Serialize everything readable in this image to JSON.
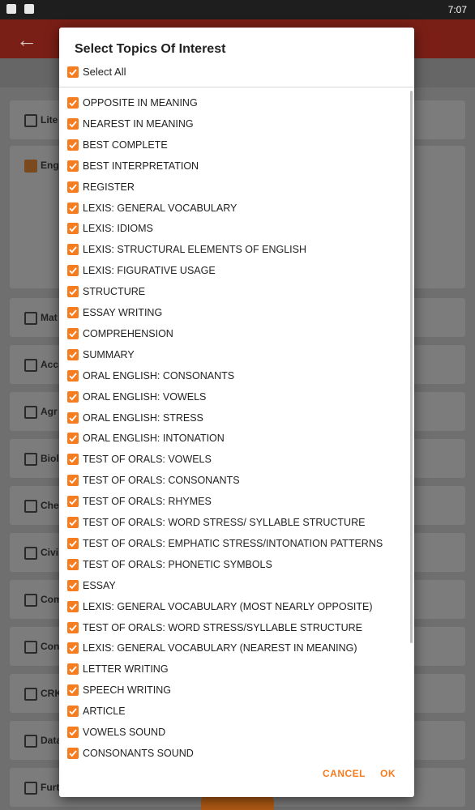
{
  "status_bar": {
    "time": "7:07"
  },
  "background": {
    "cards": [
      {
        "label": "Lite",
        "checked": false
      },
      {
        "label": "Eng",
        "checked": true
      },
      {
        "label": "Mat",
        "checked": false
      },
      {
        "label": "Acc",
        "checked": false
      },
      {
        "label": "Agr",
        "checked": false
      },
      {
        "label": "Biol",
        "checked": false
      },
      {
        "label": "Che",
        "checked": false
      },
      {
        "label": "Civi",
        "checked": false
      },
      {
        "label": "Com",
        "checked": false
      },
      {
        "label": "Con",
        "checked": false
      },
      {
        "label": "CRK",
        "checked": false
      },
      {
        "label": "Data",
        "checked": false
      },
      {
        "label": "Furt",
        "checked": false
      }
    ]
  },
  "dialog": {
    "title": "Select Topics Of Interest",
    "select_all_label": "Select All",
    "select_all_checked": true,
    "topics": [
      "OPPOSITE IN MEANING",
      "NEAREST IN MEANING",
      "BEST COMPLETE",
      "BEST INTERPRETATION",
      "REGISTER",
      "LEXIS: GENERAL VOCABULARY",
      "LEXIS: IDIOMS",
      "LEXIS: STRUCTURAL ELEMENTS OF ENGLISH",
      "LEXIS: FIGURATIVE USAGE",
      "STRUCTURE",
      "ESSAY WRITING",
      "COMPREHENSION",
      "SUMMARY",
      "ORAL ENGLISH: CONSONANTS",
      "ORAL ENGLISH: VOWELS",
      "ORAL ENGLISH: STRESS",
      "ORAL ENGLISH: INTONATION",
      "TEST OF ORALS: VOWELS",
      "TEST OF ORALS: CONSONANTS",
      "TEST OF ORALS: RHYMES",
      "TEST OF ORALS: WORD STRESS/ SYLLABLE STRUCTURE",
      "TEST OF ORALS: EMPHATIC STRESS/INTONATION PATTERNS",
      "TEST OF ORALS: PHONETIC SYMBOLS",
      "ESSAY",
      "LEXIS: GENERAL VOCABULARY (MOST NEARLY OPPOSITE)",
      "TEST OF ORALS: WORD STRESS/SYLLABLE STRUCTURE",
      "LEXIS: GENERAL VOCABULARY (NEAREST IN MEANING)",
      "LETTER WRITING",
      "SPEECH WRITING",
      "ARTICLE",
      "VOWELS SOUND",
      "CONSONANTS SOUND"
    ],
    "cancel_label": "CANCEL",
    "ok_label": "OK"
  },
  "colors": {
    "accent": "#f57c1f",
    "appbar": "#7a1f16"
  }
}
